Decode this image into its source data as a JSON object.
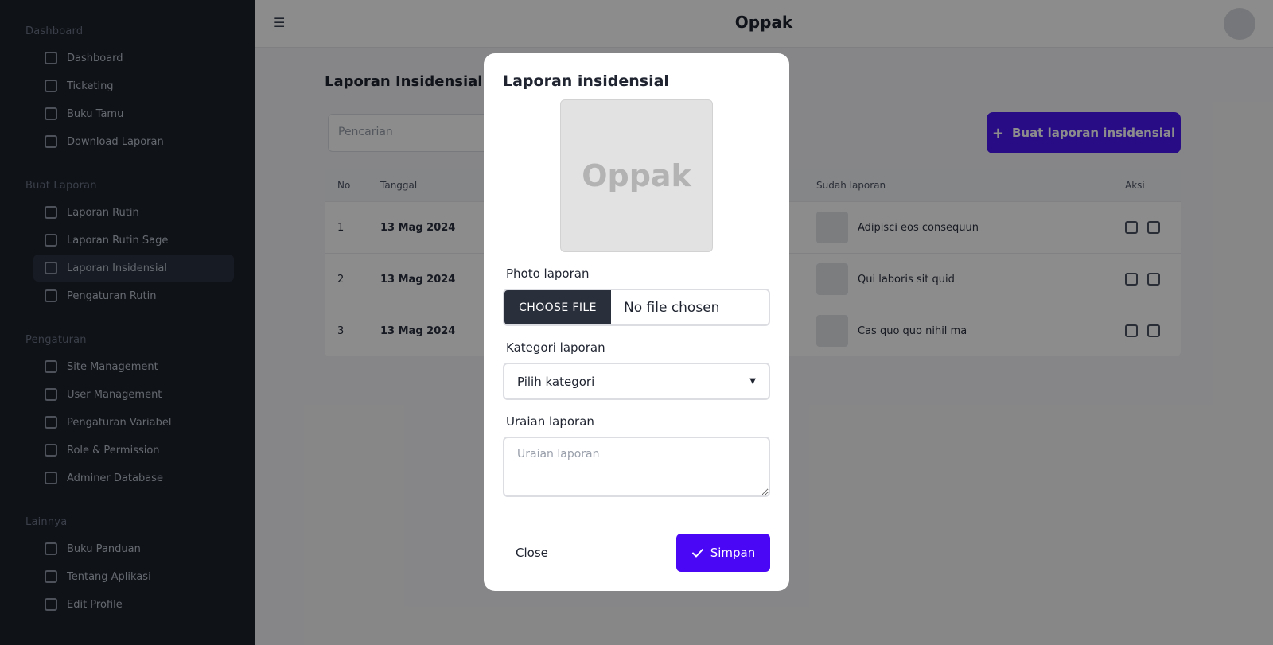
{
  "app": {
    "brand": "Oppak"
  },
  "sidebar": {
    "sections": [
      {
        "title": "Dashboard",
        "items": [
          "Dashboard",
          "Ticketing",
          "Buku Tamu",
          "Download Laporan"
        ]
      },
      {
        "title": "Buat Laporan",
        "items": [
          "Laporan Rutin",
          "Laporan Rutin Sage",
          "Laporan Insidensial",
          "Pengaturan Rutin"
        ]
      },
      {
        "title": "Pengaturan",
        "items": [
          "Site Management",
          "User Management",
          "Pengaturan Variabel",
          "Role & Permission",
          "Adminer Database"
        ]
      },
      {
        "title": "Lainnya",
        "items": [
          "Buku Panduan",
          "Tentang Aplikasi",
          "Edit Profile"
        ]
      }
    ],
    "active_item": "Laporan Insidensial"
  },
  "main": {
    "page_title": "Laporan Insidensial",
    "search_placeholder": "Pencarian",
    "add_button": "Buat laporan insidensial",
    "table": {
      "headers": [
        "No",
        "Tanggal",
        "Sudah laporan",
        "Aksi"
      ],
      "rows": [
        {
          "no": "1",
          "date": "13 Mag 2024",
          "desc": "Adipisci eos consequun"
        },
        {
          "no": "2",
          "date": "13 Mag 2024",
          "desc": "Qui laboris sit quid"
        },
        {
          "no": "3",
          "date": "13 Mag 2024",
          "desc": "Cas quo quo nihil ma"
        }
      ]
    }
  },
  "modal": {
    "title": "Laporan insidensial",
    "preview_text": "Oppak",
    "photo_label": "Photo laporan",
    "file_button": "CHOOSE FILE",
    "file_status": "No file chosen",
    "category_label": "Kategori laporan",
    "category_selected": "Pilih kategori",
    "description_label": "Uraian laporan",
    "description_placeholder": "Uraian laporan",
    "close_label": "Close",
    "save_label": "Simpan"
  },
  "colors": {
    "accent": "#4a07f5",
    "sidebar_bg": "#1c212b"
  }
}
